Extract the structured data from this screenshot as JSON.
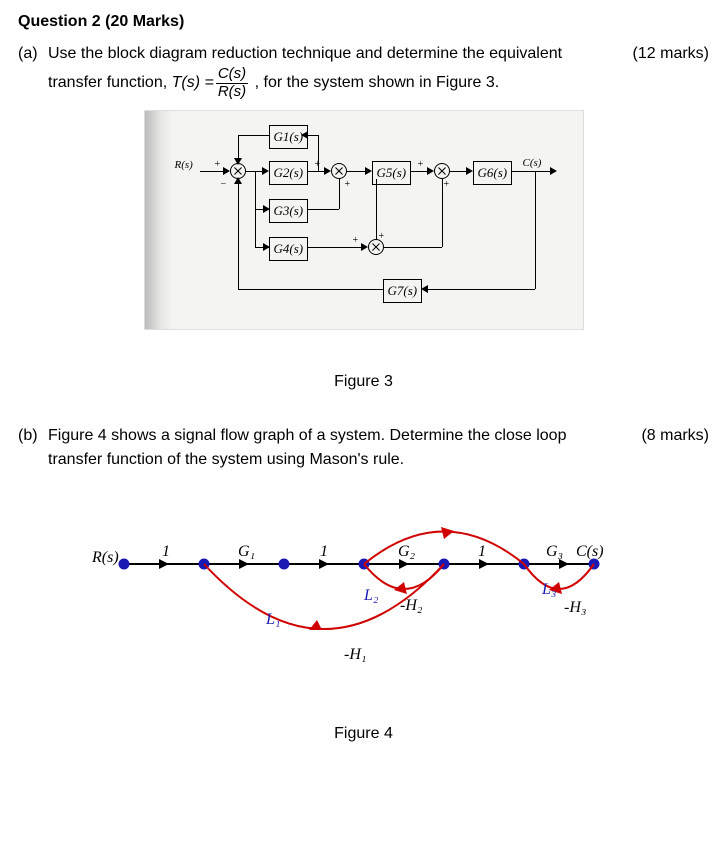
{
  "question_header": "Question 2 (20 Marks)",
  "part_a": {
    "label": "(a)",
    "text_before": "Use the block diagram reduction technique and determine the equivalent transfer function, ",
    "tf": "T(s) = ",
    "frac_num": "C(s)",
    "frac_den": "R(s)",
    "text_after": ", for the system shown in Figure 3.",
    "marks": "(12 marks)"
  },
  "figure3": {
    "caption": "Figure 3",
    "R": "R(s)",
    "C": "C(s)",
    "G1": "G1(s)",
    "G2": "G2(s)",
    "G3": "G3(s)",
    "G4": "G4(s)",
    "G5": "G5(s)",
    "G6": "G6(s)",
    "G7": "G7(s)",
    "plus": "+",
    "minus": "−"
  },
  "part_b": {
    "label": "(b)",
    "text": "Figure 4 shows a signal flow graph of a system. Determine the close loop transfer function of the system using Mason's rule.",
    "marks": "(8 marks)"
  },
  "figure4": {
    "caption": "Figure 4",
    "R": "R(s)",
    "C": "C(s)",
    "one": "1",
    "G1": "G₁",
    "G2": "G₂",
    "G3": "G₃",
    "L1": "L₁",
    "L2": "L₂",
    "L3": "L₃",
    "H1": "-H₁",
    "H2": "-H₂",
    "H3": "-H₃"
  }
}
